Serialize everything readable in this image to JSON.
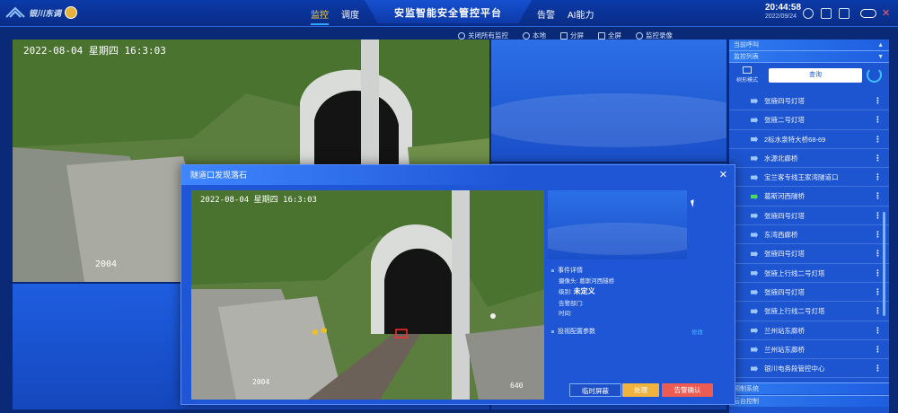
{
  "header": {
    "logo_text": "银川东调",
    "title": "安监智能安全管控平台",
    "nav_left": [
      {
        "label": "监控",
        "active": true
      },
      {
        "label": "调度",
        "active": false
      }
    ],
    "nav_right": [
      {
        "label": "告警"
      },
      {
        "label": "AI能力"
      }
    ],
    "time": "20:44:58",
    "date": "2022/09/24"
  },
  "toolbar": {
    "items": [
      {
        "label": "关闭所有监控",
        "icon": "close-circle-icon"
      },
      {
        "label": "本地",
        "icon": "local-icon"
      },
      {
        "label": "分屏",
        "icon": "split-screen-icon"
      },
      {
        "label": "全屏",
        "icon": "fullscreen-icon"
      },
      {
        "label": "监控录像",
        "icon": "record-icon"
      }
    ]
  },
  "video": {
    "timestamp": "2022-08-04 星期四 16:3:03",
    "milepost": "2004",
    "milepost_right": "640"
  },
  "sidebar": {
    "current_call": "当前呼叫",
    "monitor_list": "监控列表",
    "tree_mode": "树形模式",
    "search_label": "查询",
    "items": [
      {
        "label": "张掖四号灯塔",
        "status": "normal"
      },
      {
        "label": "张掖二号灯塔",
        "status": "normal"
      },
      {
        "label": "2标水泉特大桥68-69",
        "status": "normal"
      },
      {
        "label": "水源北廊桥",
        "status": "normal"
      },
      {
        "label": "宝兰客专线王家湾隧道口",
        "status": "normal"
      },
      {
        "label": "葛斯河西隧桥",
        "status": "online"
      },
      {
        "label": "张掖四号灯塔",
        "status": "normal"
      },
      {
        "label": "东湾西廊桥",
        "status": "normal"
      },
      {
        "label": "张掖四号灯塔",
        "status": "normal"
      },
      {
        "label": "张掖上行线二号灯塔",
        "status": "normal"
      },
      {
        "label": "张掖四号灯塔",
        "status": "normal"
      },
      {
        "label": "张掖上行线二号灯塔",
        "status": "normal"
      },
      {
        "label": "兰州站东廊桥",
        "status": "normal"
      },
      {
        "label": "兰州站东廊桥",
        "status": "normal"
      },
      {
        "label": "银川电务段管控中心",
        "status": "normal"
      }
    ],
    "footer_items": [
      {
        "label": "预制系统"
      },
      {
        "label": "云台控制"
      }
    ]
  },
  "modal": {
    "title": "隧道口发现落石",
    "section_event": "事件详情",
    "camera_label": "摄像头:",
    "camera_value": "葛斯河西隧桥",
    "level_label": "级别:",
    "level_value": "未定义",
    "dept_label": "告警部门:",
    "dept_value": "",
    "time_label": "时间:",
    "time_value": "",
    "section_params": "投视配置参数",
    "edit_label": "修改",
    "btn_block": "临时屏蔽",
    "btn_handle": "处理",
    "btn_confirm": "告警确认"
  },
  "colors": {
    "accent": "#ffd23c",
    "link": "#3ec1ff",
    "confirm": "#ec5c52",
    "handle": "#f0b340"
  }
}
